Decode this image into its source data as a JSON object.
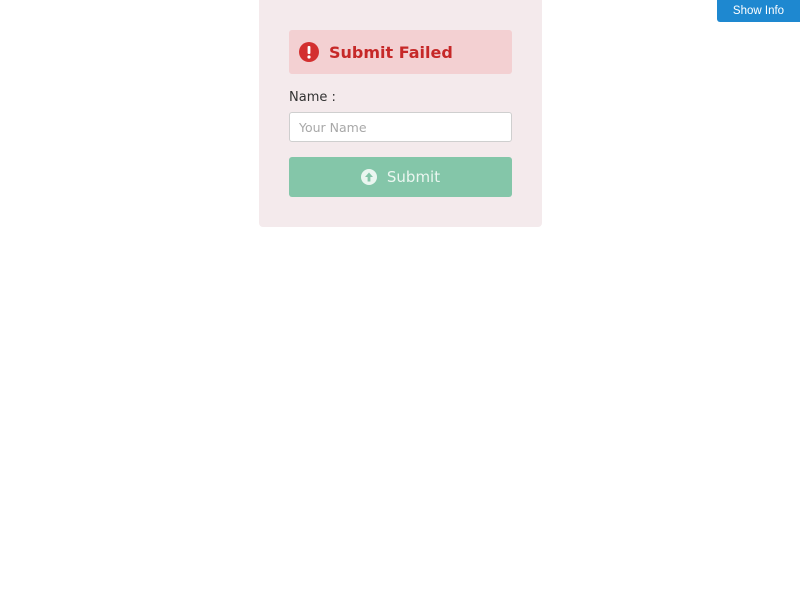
{
  "header": {
    "show_info_label": "Show Info"
  },
  "alert": {
    "icon": "exclamation-circle-icon",
    "message": "Submit Failed",
    "color": "#c62828",
    "background": "#f3d0d2"
  },
  "form": {
    "name_label": "Name :",
    "name_value": "",
    "name_placeholder": "Your Name",
    "submit_label": "Submit",
    "submit_icon": "arrow-up-circle-icon",
    "submit_color": "#84c6a9"
  },
  "panel": {
    "background": "#f4eaec"
  }
}
